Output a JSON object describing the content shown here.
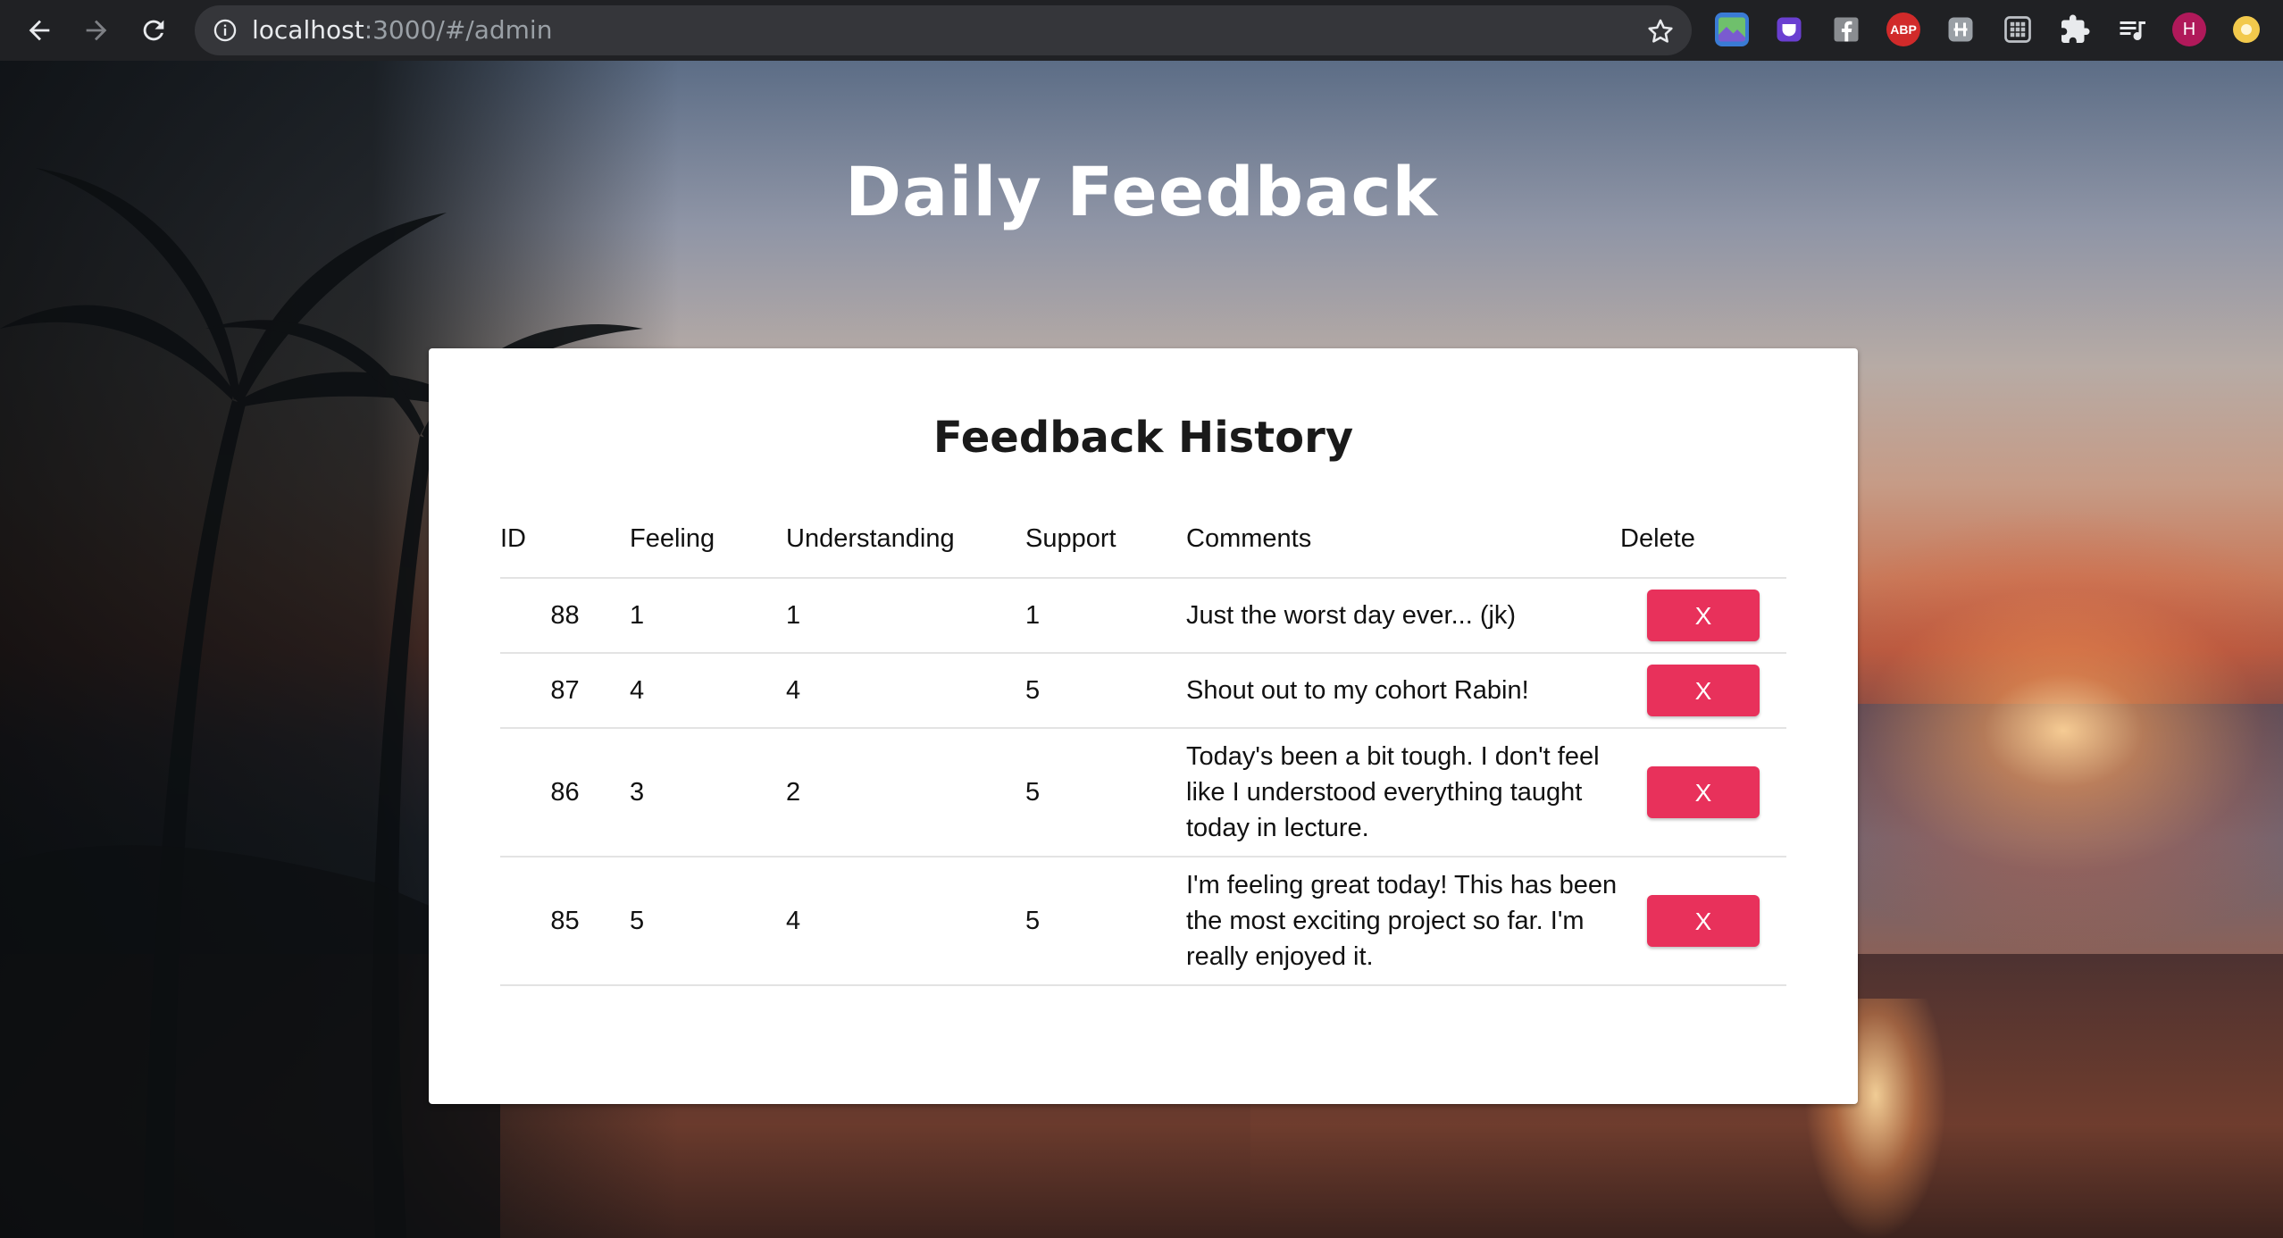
{
  "browser": {
    "url_host": "localhost",
    "url_path": ":3000/#/admin",
    "profile_initial": "H",
    "extensions": [
      "image-extension-icon",
      "shield-extension-icon",
      "facebook-extension-icon",
      "adblock-plus-icon",
      "kanji-extension-icon",
      "grid-extension-icon",
      "puzzle-icon",
      "media-queue-icon"
    ],
    "adblock_label": "ABP"
  },
  "page": {
    "heading": "Daily Feedback"
  },
  "card": {
    "title": "Feedback History",
    "columns": [
      "ID",
      "Feeling",
      "Understanding",
      "Support",
      "Comments",
      "Delete"
    ],
    "rows": [
      {
        "id": "88",
        "feeling": "1",
        "understanding": "1",
        "support": "1",
        "comments": "Just the worst day ever... (jk)",
        "delete_label": "X"
      },
      {
        "id": "87",
        "feeling": "4",
        "understanding": "4",
        "support": "5",
        "comments": "Shout out to my cohort Rabin!",
        "delete_label": "X"
      },
      {
        "id": "86",
        "feeling": "3",
        "understanding": "2",
        "support": "5",
        "comments": "Today's been a bit tough. I don't feel like I understood everything taught today in lecture.",
        "delete_label": "X"
      },
      {
        "id": "85",
        "feeling": "5",
        "understanding": "4",
        "support": "5",
        "comments": "I'm feeling great today! This has been the most exciting project so far. I'm really enjoyed it.",
        "delete_label": "X"
      }
    ]
  },
  "colors": {
    "delete_button": "#e8315b",
    "chrome_background": "#202124",
    "profile_avatar": "#b0195a"
  }
}
